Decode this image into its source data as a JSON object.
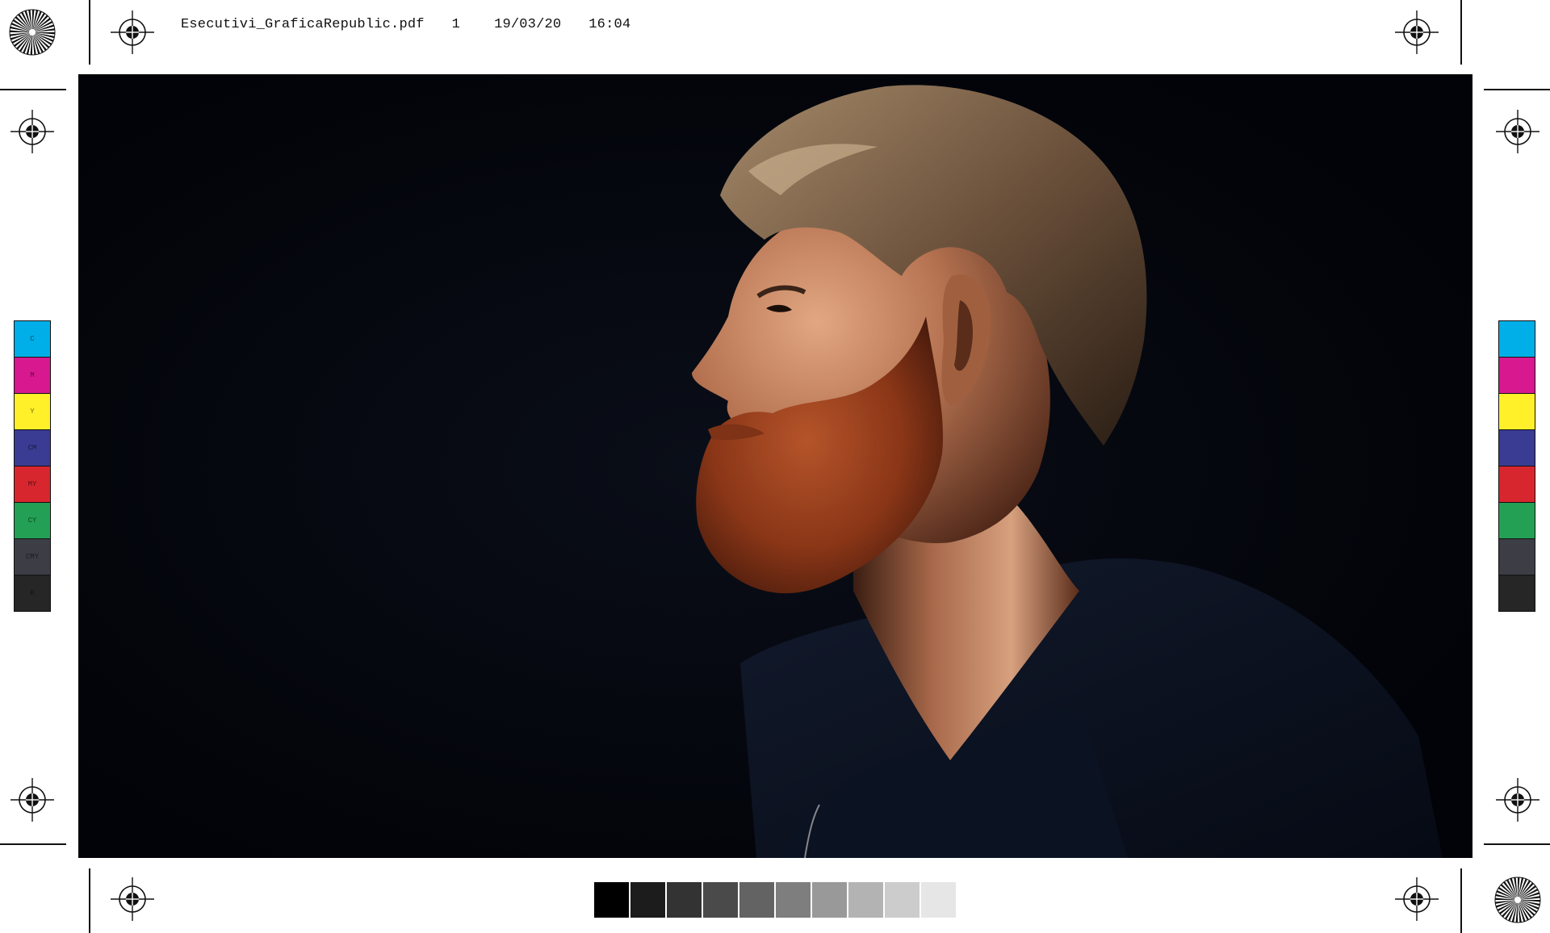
{
  "slug": {
    "filename": "Esecutivi_GraficaRepublic.pdf",
    "page": "1",
    "date": "19/03/20",
    "time": "16:04"
  },
  "color_bar_left": [
    {
      "label": "C",
      "color": "#00aee8"
    },
    {
      "label": "M",
      "color": "#d8188f"
    },
    {
      "label": "Y",
      "color": "#fff02a"
    },
    {
      "label": "CM",
      "color": "#3a3c93"
    },
    {
      "label": "MY",
      "color": "#d8262e"
    },
    {
      "label": "CY",
      "color": "#24a055"
    },
    {
      "label": "CMY",
      "color": "#3c3d45"
    },
    {
      "label": "K",
      "color": "#262626"
    }
  ],
  "color_bar_right": [
    {
      "color": "#00aee8"
    },
    {
      "color": "#d8188f"
    },
    {
      "color": "#fff02a"
    },
    {
      "color": "#3a3c93"
    },
    {
      "color": "#d8262e"
    },
    {
      "color": "#24a055"
    },
    {
      "color": "#3c3d45"
    },
    {
      "color": "#262626"
    }
  ],
  "gray_scale": [
    "#000000",
    "#1c1c1c",
    "#333333",
    "#4a4a4a",
    "#636363",
    "#7e7e7e",
    "#999999",
    "#b3b3b3",
    "#cccccc",
    "#e6e6e6"
  ],
  "photo": {
    "subject": "profile portrait of a bearded man against a black background",
    "background_color": "#03050b"
  }
}
